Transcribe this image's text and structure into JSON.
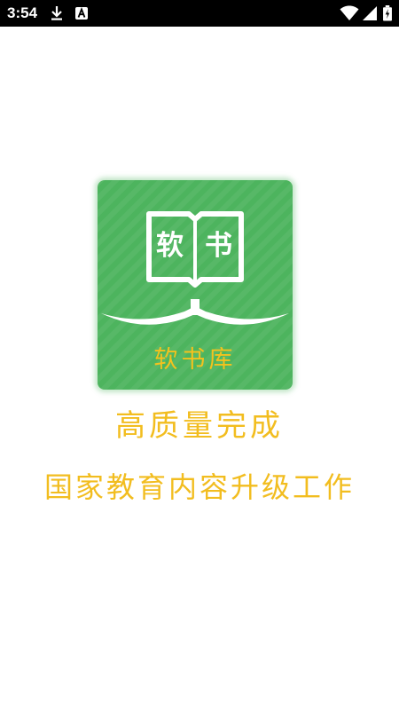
{
  "status_bar": {
    "time": "3:54",
    "icons": [
      "download-icon",
      "text-a-icon",
      "wifi-icon",
      "signal-icon",
      "battery-charging-icon"
    ]
  },
  "logo": {
    "book_char_left": "软",
    "book_char_right": "书",
    "name": "软书库",
    "colors": {
      "background": "#4db45e",
      "name": "#f4c21d",
      "book": "#ffffff"
    }
  },
  "slogan": {
    "line1": "高质量完成",
    "line2": "国家教育内容升级工作",
    "color": "#f2bd1f"
  }
}
